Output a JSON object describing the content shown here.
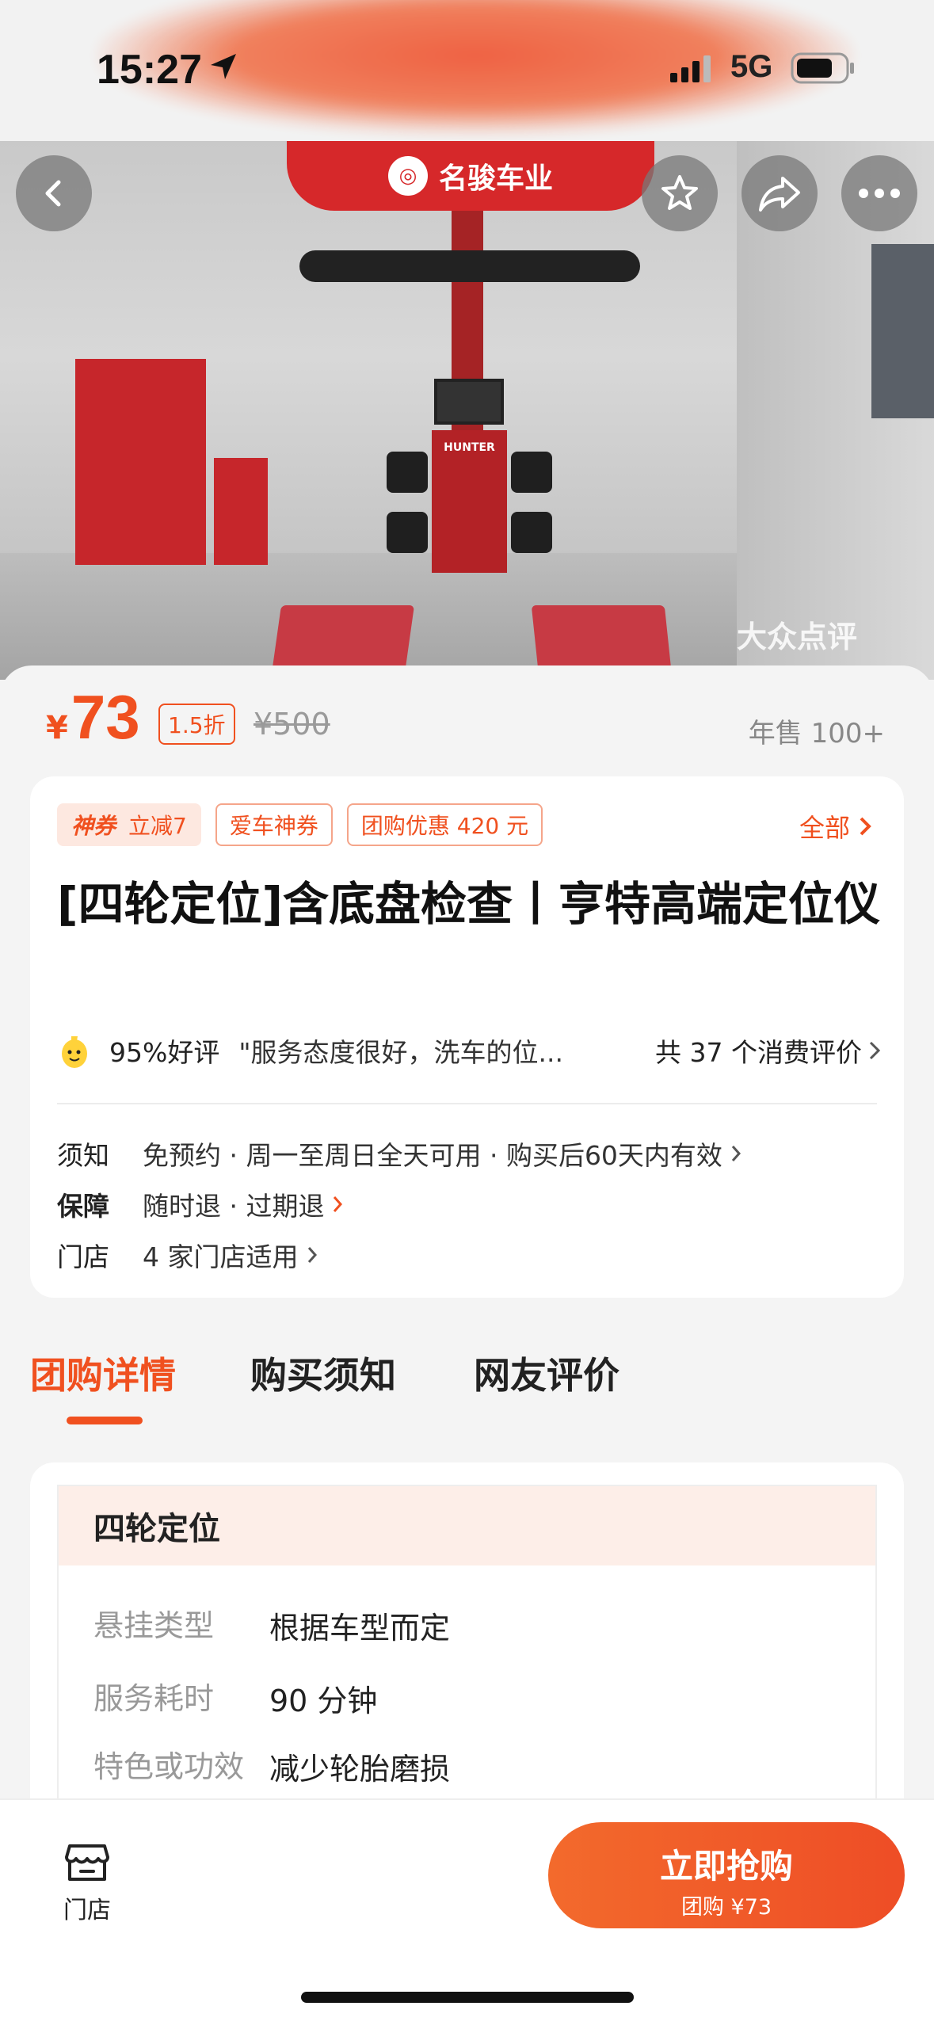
{
  "status_bar": {
    "time": "15:27",
    "network": "5G"
  },
  "hero": {
    "brand": "名骏车业",
    "watermark": "大众点评",
    "machine_label": "HUNTER"
  },
  "price": {
    "currency": "¥",
    "current": "73",
    "discount": "1.5折",
    "original": "¥500",
    "sold": "年售 100+"
  },
  "coupons": {
    "tags": [
      "神券",
      "立减7",
      "爱车神券",
      "团购优惠 420 元"
    ],
    "all_label": "全部"
  },
  "product": {
    "title": "[四轮定位]含底盘检查丨亨特高端定位仪"
  },
  "review": {
    "rate": "95%好评",
    "quote": "\"服务态度很好，洗车的位...",
    "total": "共 37 个消费评价"
  },
  "info": [
    {
      "key": "须知",
      "value": "免预约 · 周一至周日全天可用 · 购买后60天内有效"
    },
    {
      "key": "保障",
      "value": "随时退 · 过期退"
    },
    {
      "key": "门店",
      "value": "4 家门店适用"
    }
  ],
  "tabs": [
    "团购详情",
    "购买须知",
    "网友评价"
  ],
  "detail": {
    "heading": "四轮定位",
    "rows": [
      {
        "key": "悬挂类型",
        "value": "根据车型而定"
      },
      {
        "key": "服务耗时",
        "value": "90 分钟"
      },
      {
        "key": "特色或功效",
        "value": "减少轮胎磨损"
      }
    ]
  },
  "bottom": {
    "store_label": "门店",
    "buy_label": "立即抢购",
    "buy_sub": "团购 ¥73"
  },
  "colors": {
    "accent": "#f0501f",
    "brand_red": "#d6282a"
  },
  "icons": [
    "back-icon",
    "star-icon",
    "share-icon",
    "more-icon",
    "store-icon",
    "chevron-right-icon",
    "location-arrow-icon"
  ]
}
